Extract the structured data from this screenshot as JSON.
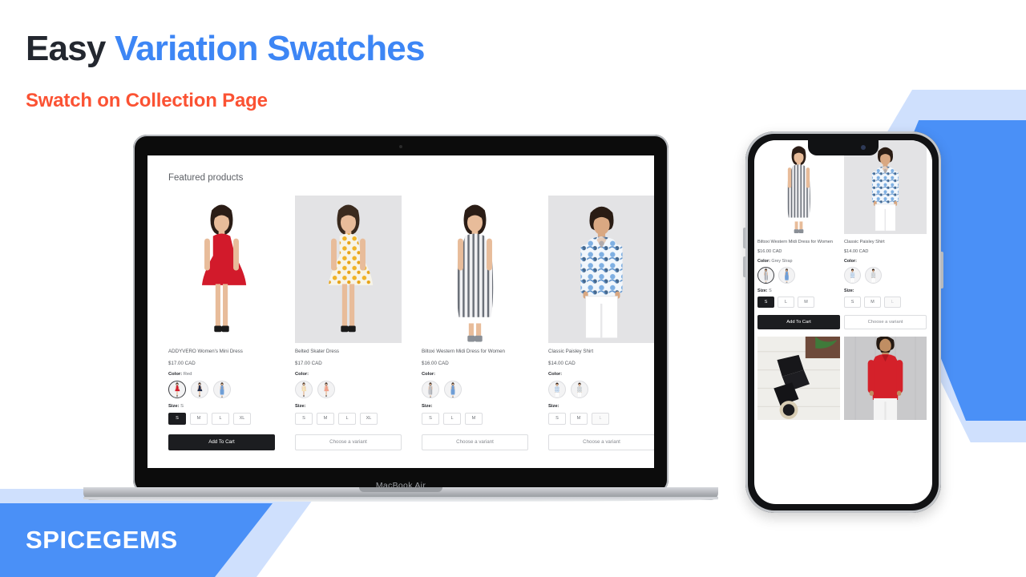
{
  "headline": {
    "part1": "Easy",
    "part2": "Variation Swatches"
  },
  "subheadline": "Swatch on Collection Page",
  "brand": "SPICEGEMS",
  "colors": {
    "accent_blue": "#3d86f5",
    "accent_orange": "#fb5233",
    "band_blue": "#4a90f7",
    "band_light_blue": "#cfe0fd",
    "dark": "#1c1d20"
  },
  "laptop": {
    "model_label": "MacBook Air",
    "page": {
      "title": "Featured products",
      "labels": {
        "color": "Color:",
        "size": "Size:"
      },
      "products": [
        {
          "title": "ADDYVERO Women's Mini Dress",
          "price": "$17.00 CAD",
          "color_value": "Red",
          "image_bg": "white",
          "swatches": [
            {
              "name": "red-dress-swatch",
              "selected": true
            },
            {
              "name": "navy-dress-swatch",
              "selected": false
            },
            {
              "name": "blue-dress-swatch",
              "selected": false
            }
          ],
          "size_value": "S",
          "sizes": [
            {
              "label": "S",
              "state": "selected"
            },
            {
              "label": "M",
              "state": "normal"
            },
            {
              "label": "L",
              "state": "normal"
            },
            {
              "label": "XL",
              "state": "normal"
            }
          ],
          "cta": "Add To Cart",
          "cta_style": "primary"
        },
        {
          "title": "Belted Skater Dress",
          "price": "$17.00 CAD",
          "color_value": "",
          "image_bg": "grey",
          "swatches": [
            {
              "name": "floral-dress-swatch",
              "selected": false
            },
            {
              "name": "peach-dress-swatch",
              "selected": false
            }
          ],
          "size_value": "",
          "sizes": [
            {
              "label": "S",
              "state": "normal"
            },
            {
              "label": "M",
              "state": "normal"
            },
            {
              "label": "L",
              "state": "normal"
            },
            {
              "label": "XL",
              "state": "normal"
            }
          ],
          "cta": "Choose a variant",
          "cta_style": "ghost"
        },
        {
          "title": "Biltoxi Western Midi Dress for Women",
          "price": "$16.00 CAD",
          "color_value": "",
          "image_bg": "white",
          "swatches": [
            {
              "name": "grey-strap-dress-swatch",
              "selected": false
            },
            {
              "name": "blue-dress-swatch",
              "selected": false
            }
          ],
          "size_value": "",
          "sizes": [
            {
              "label": "S",
              "state": "normal"
            },
            {
              "label": "L",
              "state": "normal"
            },
            {
              "label": "M",
              "state": "normal"
            }
          ],
          "cta": "Choose a variant",
          "cta_style": "ghost"
        },
        {
          "title": "Classic Paisley Shirt",
          "price": "$14.00 CAD",
          "color_value": "",
          "image_bg": "grey",
          "swatches": [
            {
              "name": "blue-paisley-shirt-swatch",
              "selected": false
            },
            {
              "name": "grey-paisley-shirt-swatch",
              "selected": false
            }
          ],
          "size_value": "",
          "sizes": [
            {
              "label": "S",
              "state": "normal"
            },
            {
              "label": "M",
              "state": "normal"
            },
            {
              "label": "L",
              "state": "disabled"
            }
          ],
          "cta": "Choose a variant",
          "cta_style": "ghost"
        }
      ]
    }
  },
  "phone": {
    "labels": {
      "color": "Color:",
      "size": "Size:"
    },
    "products": [
      {
        "title": "Biltoxi Western Midi Dress for Women",
        "price": "$16.00 CAD",
        "color_value": "Grey Strap",
        "image_bg": "white",
        "swatches": [
          {
            "name": "grey-strap-dress-swatch",
            "selected": true
          },
          {
            "name": "blue-dress-swatch",
            "selected": false
          }
        ],
        "size_value": "S",
        "sizes": [
          {
            "label": "S",
            "state": "selected"
          },
          {
            "label": "L",
            "state": "normal"
          },
          {
            "label": "M",
            "state": "normal"
          }
        ],
        "cta": "Add To Cart",
        "cta_style": "primary"
      },
      {
        "title": "Classic Paisley Shirt",
        "price": "$14.00 CAD",
        "color_value": "",
        "image_bg": "grey",
        "swatches": [
          {
            "name": "blue-paisley-shirt-swatch",
            "selected": false
          },
          {
            "name": "grey-paisley-shirt-swatch",
            "selected": false
          }
        ],
        "size_value": "",
        "sizes": [
          {
            "label": "S",
            "state": "normal"
          },
          {
            "label": "M",
            "state": "normal"
          },
          {
            "label": "L",
            "state": "disabled"
          }
        ],
        "cta": "Choose a variant",
        "cta_style": "ghost"
      }
    ],
    "bottom_row": [
      {
        "name": "black-belt-product-image"
      },
      {
        "name": "red-kurta-product-image"
      }
    ]
  }
}
